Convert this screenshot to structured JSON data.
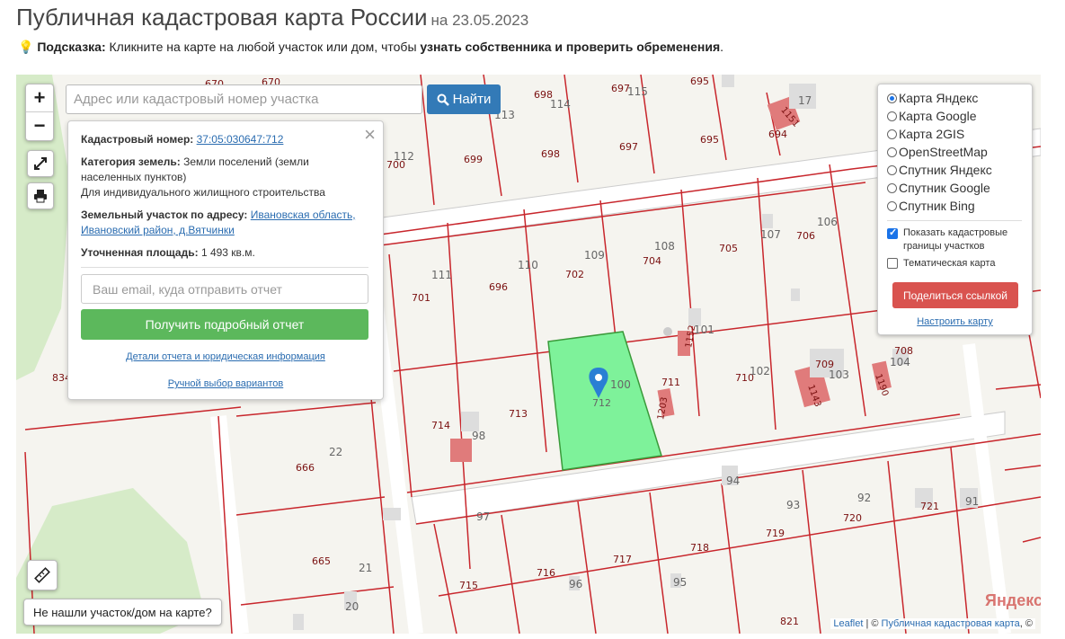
{
  "header": {
    "title": "Публичная кадастровая карта России",
    "date": "на 23.05.2023"
  },
  "hint": {
    "label": "Подсказка:",
    "text": " Кликните на карте на любой участок или дом, чтобы ",
    "bold": "узнать собственника и проверить обременения",
    "end": "."
  },
  "map": {
    "search_placeholder": "Адрес или кадастровый номер участка",
    "search_button": "Найти",
    "zoom_in": "+",
    "zoom_out": "−",
    "info": {
      "cad_label": "Кадастровый номер:",
      "cad_value": "37:05:030647:712",
      "cat_label": "Категория земель:",
      "cat_value": "Земли поселений (земли",
      "cat_value2": "населенных пунктов)",
      "cat_use": "Для индивидуального жилищного строительства",
      "addr_label": "Земельный участок по адресу:",
      "addr_value": "Ивановская область,",
      "addr_value2": "Ивановский район, д.Вятчинки",
      "area_label": "Уточненная площадь:",
      "area_value": "1 493 кв.м.",
      "email_placeholder": "Ваш email, куда отправить отчет",
      "report_button": "Получить подробный отчет",
      "details_link": "Детали отчета и юридическая информация",
      "manual_link": "Ручной выбор вариантов"
    },
    "layers": {
      "options": [
        {
          "label": "Карта Яндекс",
          "selected": true
        },
        {
          "label": "Карта Google",
          "selected": false
        },
        {
          "label": "Карта 2GIS",
          "selected": false
        },
        {
          "label": "OpenStreetMap",
          "selected": false
        },
        {
          "label": "Спутник Яндекс",
          "selected": false
        },
        {
          "label": "Спутник Google",
          "selected": false
        },
        {
          "label": "Спутник Bing",
          "selected": false
        }
      ],
      "show_borders": "Показать кадастровые",
      "show_borders2": "границы участков",
      "thematic": "Тематическая карта",
      "share_button": "Поделиться ссылкой",
      "setup_link": "Настроить карту"
    },
    "not_found_button": "Не нашли участок/дом на карте?",
    "attribution": {
      "leaflet": "Leaflet",
      "sep": " | © ",
      "pkk": "Публичная кадастровая карта",
      "end": ", ©"
    },
    "yandex_logo": "Яндекс",
    "selected_parcel": "712",
    "parcel_labels": [
      "670",
      "670",
      "698",
      "697",
      "695",
      "694",
      "699",
      "698",
      "697",
      "695",
      "700",
      "701",
      "696",
      "702",
      "704",
      "705",
      "706",
      "708",
      "709",
      "710",
      "711",
      "713",
      "714",
      "666",
      "665",
      "715",
      "716",
      "717",
      "718",
      "719",
      "720",
      "721",
      "821",
      "834",
      "1151",
      "1152",
      "1143",
      "1190",
      "1203"
    ],
    "house_numbers": [
      "115",
      "114",
      "113",
      "112",
      "17",
      "111",
      "110",
      "109",
      "108",
      "107",
      "106",
      "101",
      "102",
      "103",
      "104",
      "100",
      "98",
      "97",
      "96",
      "95",
      "94",
      "93",
      "92",
      "91",
      "22",
      "21",
      "20"
    ],
    "colors": {
      "parcel_line": "#c8262c",
      "selected_fill": "#7ef29a",
      "building": "#e07b7b",
      "accent": "#337ab7",
      "report": "#5cb85c",
      "share": "#d9534f"
    }
  }
}
